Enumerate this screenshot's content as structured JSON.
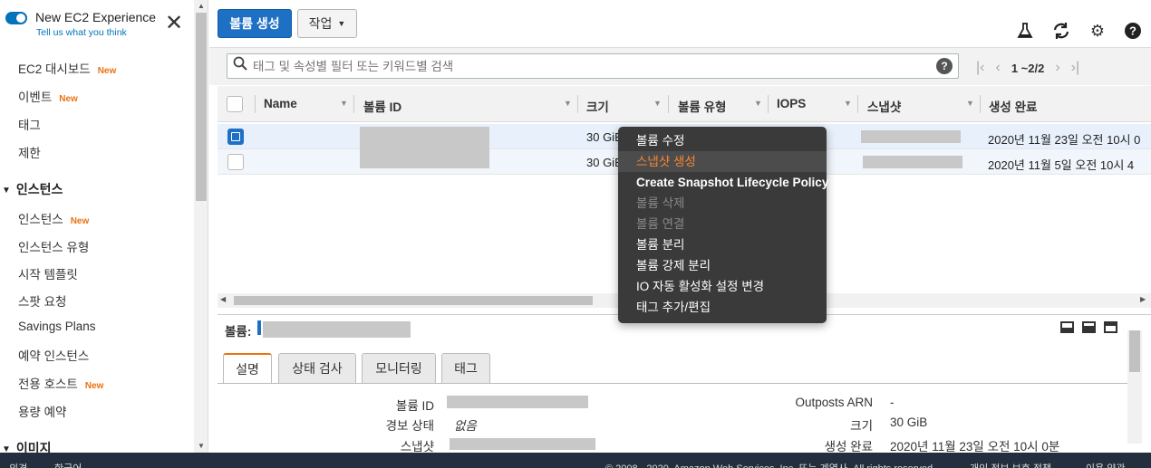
{
  "sidebar": {
    "experience_title": "New EC2 Experience",
    "experience_link": "Tell us what you think",
    "new_badge": "New",
    "items": [
      {
        "label": "EC2 대시보드",
        "new": true
      },
      {
        "label": "이벤트",
        "new": true
      },
      {
        "label": "태그",
        "new": false
      },
      {
        "label": "제한",
        "new": false
      }
    ],
    "section_instances": "인스턴스",
    "instance_items": [
      {
        "label": "인스턴스",
        "new": true
      },
      {
        "label": "인스턴스 유형",
        "new": false
      },
      {
        "label": "시작 템플릿",
        "new": false
      },
      {
        "label": "스팟 요청",
        "new": false
      },
      {
        "label": "Savings Plans",
        "new": false
      },
      {
        "label": "예약 인스턴스",
        "new": false
      },
      {
        "label": "전용 호스트",
        "new": true
      },
      {
        "label": "용량 예약",
        "new": false
      }
    ],
    "section_images": "이미지"
  },
  "toolbar": {
    "create_volume": "볼륨 생성",
    "actions": "작업",
    "icons": [
      "flask-icon",
      "refresh-icon",
      "gear-icon",
      "help-icon"
    ]
  },
  "search": {
    "placeholder": "태그 및 속성별 필터 또는 키워드별 검색",
    "pagination": "1 ~2/2"
  },
  "table": {
    "columns": [
      "Name",
      "볼륨 ID",
      "크기",
      "볼륨 유형",
      "IOPS",
      "스냅샷",
      "생성 완료"
    ],
    "rows": [
      {
        "selected": true,
        "size": "30 GiB",
        "created": "2020년 11월 23일 오전 10시 0"
      },
      {
        "selected": false,
        "size": "30 GiB",
        "created": "2020년 11월 5일 오전 10시 4"
      }
    ]
  },
  "detail": {
    "label": "볼륨:",
    "tabs": [
      "설명",
      "상태 검사",
      "모니터링",
      "태그"
    ],
    "left": [
      {
        "key": "볼륨 ID",
        "value": ""
      },
      {
        "key": "경보 상태",
        "value": "없음"
      },
      {
        "key": "스냅샷",
        "value": ""
      }
    ],
    "right": [
      {
        "key": "Outposts ARN",
        "value": "-"
      },
      {
        "key": "크기",
        "value": "30 GiB"
      },
      {
        "key": "생성 완료",
        "value": "2020년 11월 23일 오전 10시 0분"
      }
    ]
  },
  "context_menu": [
    {
      "label": "볼륨 수정",
      "state": "normal"
    },
    {
      "label": "스냅샷 생성",
      "state": "highlighted"
    },
    {
      "label": "Create Snapshot Lifecycle Policy",
      "state": "normal"
    },
    {
      "label": "볼륨 삭제",
      "state": "disabled"
    },
    {
      "label": "볼륨 연결",
      "state": "disabled"
    },
    {
      "label": "볼륨 분리",
      "state": "normal"
    },
    {
      "label": "볼륨 강제 분리",
      "state": "normal"
    },
    {
      "label": "IO 자동 활성화 설정 변경",
      "state": "normal"
    },
    {
      "label": "태그 추가/편집",
      "state": "normal"
    }
  ],
  "footer": {
    "feedback": "의견",
    "language": "한국어",
    "copyright": "© 2008 - 2020, Amazon Web Services, Inc. 또는 계열사. All rights reserved.",
    "privacy": "개인 정보 보호 정책",
    "terms": "이용 약관"
  },
  "colors": {
    "primary": "#1e70c4",
    "accent": "#ec7211",
    "menu_bg": "#3a3a3a",
    "footer_bg": "#232f3e"
  }
}
